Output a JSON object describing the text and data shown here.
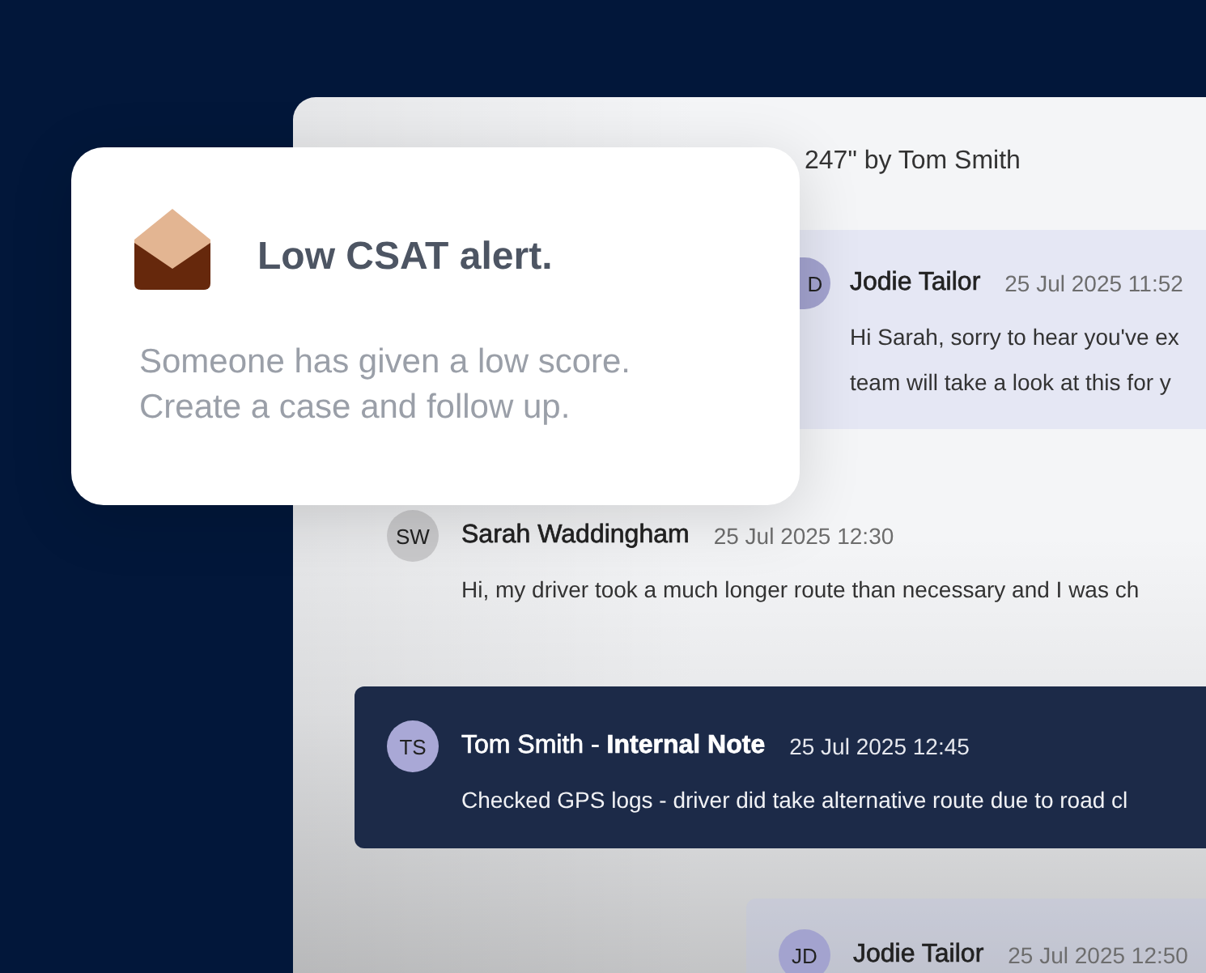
{
  "alert": {
    "title": "Low CSAT alert.",
    "message": "Someone has given a low score. Create a case and follow up."
  },
  "conversation": {
    "header": "247\" by Tom Smith",
    "messages": [
      {
        "kind": "agent",
        "initials": "D",
        "author": "Jodie Tailor",
        "time": "25 Jul 2025 11:52",
        "body": "Hi Sarah, sorry to hear you've ex\nteam will take a look at this for y"
      },
      {
        "kind": "customer",
        "initials": "SW",
        "author": "Sarah Waddingham",
        "time": "25 Jul 2025 12:30",
        "body": "Hi, my driver took a much longer route than necessary and I was ch"
      },
      {
        "kind": "note",
        "initials": "TS",
        "author": "Tom Smith - **Internal Note**",
        "time": "25 Jul 2025 12:45",
        "body": "Checked GPS logs - driver did take alternative route due to road cl"
      },
      {
        "kind": "agent",
        "initials": "JD",
        "author": "Jodie Tailor",
        "time": "25 Jul 2025 12:50"
      }
    ]
  }
}
